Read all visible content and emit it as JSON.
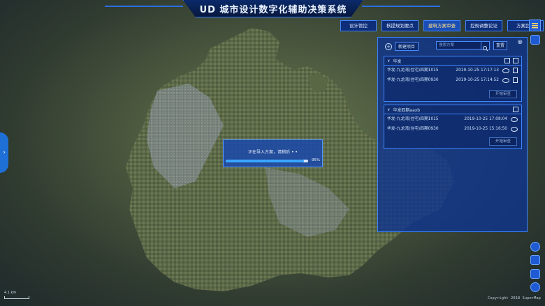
{
  "app": {
    "title": "UD 城市设计数字化辅助决策系统"
  },
  "top_buttons": [
    {
      "label": "设计管控",
      "active": false
    },
    {
      "label": "核提规划要点",
      "active": false
    },
    {
      "label": "建筑方案审查",
      "active": true
    },
    {
      "label": "控规调整论证",
      "active": false
    },
    {
      "label": "方案比选",
      "active": false
    }
  ],
  "panel": {
    "new_project_label": "新建项目",
    "search_placeholder": "搜索方案",
    "reset_label": "重置",
    "groups": [
      {
        "name": "华发",
        "rows": [
          {
            "name": "华发-九龙湾(住宅)四期1015",
            "datetime": "2019-10-25 17:17:13"
          },
          {
            "name": "华发-九龙湾(住宅)四期0930",
            "datetime": "2019-10-25 17:14:52"
          }
        ],
        "review_label": "开始审查"
      },
      {
        "name": "华发四期aaxb",
        "rows": [
          {
            "name": "华发-九龙湾(住宅)四期1015",
            "datetime": "2019-10-25 17:08:04"
          },
          {
            "name": "华发-九龙湾(住宅)四期0930",
            "datetime": "2019-10-25 15:16:50"
          }
        ],
        "review_label": "开始审查"
      }
    ]
  },
  "progress": {
    "text": "正在导入方案，请稍后 • •",
    "percent_label": "95%",
    "percent": 95
  },
  "map": {
    "copyright": "Copyright 2018 SuperMap",
    "scale": "4.1 km"
  },
  "colors": {
    "accent": "#3a86ff",
    "panel": "#10348c",
    "active_text": "#ffe28a"
  }
}
